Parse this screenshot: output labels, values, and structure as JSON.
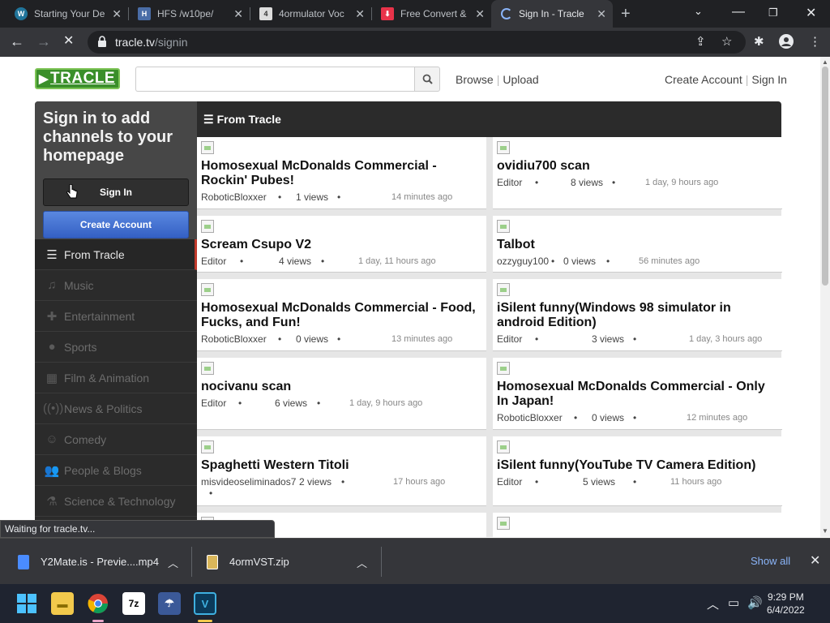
{
  "browser": {
    "tabs": [
      {
        "label": "Starting Your De",
        "icon": "wordpress-icon"
      },
      {
        "label": "HFS /w10pe/",
        "icon": "hfs-icon"
      },
      {
        "label": "4ormulator Voc",
        "icon": "site-icon"
      },
      {
        "label": "Free Convert &",
        "icon": "download-icon"
      },
      {
        "label": "Sign In - Tracle",
        "icon": "loading-spinner-icon"
      }
    ],
    "url_host": "tracle.tv",
    "url_path": "/signin",
    "status": "Waiting for tracle.tv..."
  },
  "site": {
    "logo_text": "TRACLE",
    "search_placeholder": "",
    "nav": {
      "browse": "Browse",
      "upload": "Upload"
    },
    "account": {
      "create": "Create Account",
      "signin": "Sign In"
    }
  },
  "sidebar": {
    "signin_title": "Sign in to add channels to your homepage",
    "signin_button": "Sign In",
    "create_button": "Create Account",
    "categories": [
      {
        "label": "From Tracle",
        "icon": "list-icon"
      },
      {
        "label": "Music",
        "icon": "headphones-icon"
      },
      {
        "label": "Entertainment",
        "icon": "gamepad-icon"
      },
      {
        "label": "Sports",
        "icon": "ball-icon"
      },
      {
        "label": "Film & Animation",
        "icon": "film-icon"
      },
      {
        "label": "News & Politics",
        "icon": "broadcast-icon"
      },
      {
        "label": "Comedy",
        "icon": "mask-icon"
      },
      {
        "label": "People & Blogs",
        "icon": "people-icon"
      },
      {
        "label": "Science & Technology",
        "icon": "flask-icon"
      }
    ]
  },
  "main": {
    "heading": "From Tracle",
    "videos": [
      {
        "title": "Homosexual McDonalds Commercial - Rockin' Pubes!",
        "author": "RoboticBloxxer",
        "views": "1 views",
        "ago": "14 minutes ago"
      },
      {
        "title": "ovidiu700 scan",
        "author": "Editor",
        "views": "8 views",
        "ago": "1 day, 9 hours ago"
      },
      {
        "title": "Scream Csupo V2",
        "author": "Editor",
        "views": "4 views",
        "ago": "1 day, 11 hours ago"
      },
      {
        "title": "Talbot",
        "author": "ozzyguy100",
        "views": "0 views",
        "ago": "56 minutes ago"
      },
      {
        "title": "Homosexual McDonalds Commercial - Food, Fucks, and Fun!",
        "author": "RoboticBloxxer",
        "views": "0 views",
        "ago": "13 minutes ago"
      },
      {
        "title": "iSilent funny(Windows 98 simulator in android Edition)",
        "author": "Editor",
        "views": "3 views",
        "ago": "1 day, 3 hours ago"
      },
      {
        "title": "nocivanu scan",
        "author": "Editor",
        "views": "6 views",
        "ago": "1 day, 9 hours ago"
      },
      {
        "title": "Homosexual McDonalds Commercial - Only In Japan!",
        "author": "RoboticBloxxer",
        "views": "0 views",
        "ago": "12 minutes ago"
      },
      {
        "title": "Spaghetti Western Titoli",
        "author": "misvideoseliminados7",
        "views": "2 views",
        "ago": "17 hours ago"
      },
      {
        "title": "iSilent funny(YouTube TV Camera Edition)",
        "author": "Editor",
        "views": "5 views",
        "ago": "11 hours ago"
      }
    ]
  },
  "downloads": {
    "items": [
      {
        "name": "Y2Mate.is - Previe....mp4"
      },
      {
        "name": "4ormVST.zip"
      }
    ],
    "show_all": "Show all"
  },
  "taskbar": {
    "time": "9:29 PM",
    "date": "6/4/2022"
  },
  "colors": {
    "brand": "#3a8f2a",
    "create_button": "#3f6bd0",
    "active_marker": "#c0392b"
  }
}
